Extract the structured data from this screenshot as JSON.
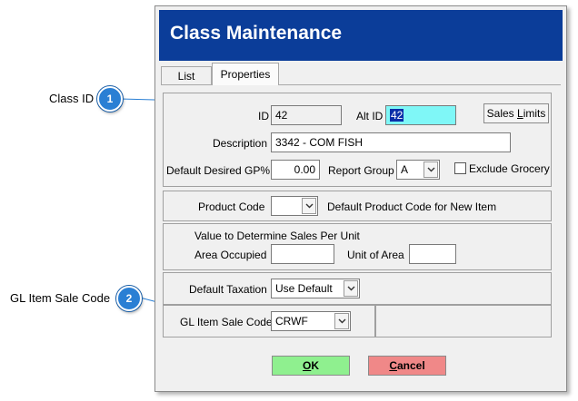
{
  "callouts": [
    {
      "number": "1",
      "label": "Class ID"
    },
    {
      "number": "2",
      "label": "GL Item Sale Code"
    }
  ],
  "window": {
    "title": "Class Maintenance",
    "tabs": [
      {
        "label": "List",
        "active": false
      },
      {
        "label": "Properties",
        "active": true
      }
    ]
  },
  "form": {
    "id_label": "ID",
    "id_value": "42",
    "alt_id_label": "Alt ID",
    "alt_id_value": "42",
    "sales_limits_pre": "Sales ",
    "sales_limits_hot": "L",
    "sales_limits_post": "imits",
    "description_label": "Description",
    "description_value": "3342 - COM FISH",
    "gp_label": "Default Desired GP%",
    "gp_value": "0.00",
    "report_group_label": "Report Group",
    "report_group_value": "A",
    "exclude_grocery_label": "Exclude Grocery",
    "exclude_grocery_checked": false,
    "product_code_label": "Product Code",
    "product_code_value": "",
    "product_code_hint": "Default Product Code for New Item",
    "sales_unit_heading": "Value to Determine Sales Per Unit",
    "area_occupied_label": "Area Occupied",
    "area_occupied_value": "",
    "unit_of_area_label": "Unit of Area",
    "unit_of_area_value": "",
    "taxation_label": "Default Taxation",
    "taxation_value": "Use Default",
    "gl_label": "GL Item Sale Code",
    "gl_value": "CRWF"
  },
  "buttons": {
    "ok_hot": "O",
    "ok_rest": "K",
    "cancel_hot": "C",
    "cancel_rest": "ancel"
  },
  "colors": {
    "title_bar": "#0b3d99",
    "callout_badge": "#2a7fd4",
    "ok_button": "#8ff08f",
    "cancel_button": "#f08888",
    "alt_id_highlight": "#7ff7f7"
  }
}
